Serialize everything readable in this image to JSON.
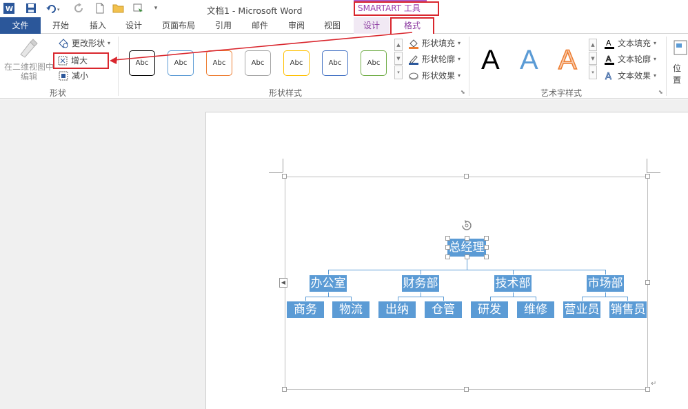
{
  "titlebar": {
    "doc_title": "文档1 - Microsoft Word",
    "tools_label": "SMARTART 工具"
  },
  "tabs": [
    "文件",
    "开始",
    "插入",
    "设计",
    "页面布局",
    "引用",
    "邮件",
    "审阅",
    "视图",
    "设计",
    "格式"
  ],
  "ribbon": {
    "shapes_group": {
      "edit_in_2d": "在二维视图中",
      "edit_in_2d_line2": "编辑",
      "change_shape": "更改形状",
      "enlarge": "增大",
      "shrink": "减小",
      "label": "形状"
    },
    "shape_styles": {
      "sample_text": "Abc",
      "styles": [
        {
          "border": "#000000"
        },
        {
          "border": "#5b9bd5"
        },
        {
          "border": "#ed7d31"
        },
        {
          "border": "#a5a5a5"
        },
        {
          "border": "#ffc000"
        },
        {
          "border": "#4472c4"
        },
        {
          "border": "#70ad47"
        }
      ],
      "fill": "形状填充",
      "outline": "形状轮廓",
      "effects": "形状效果",
      "label": "形状样式"
    },
    "wordart": {
      "letter": "A",
      "text_fill": "文本填充",
      "text_outline": "文本轮廓",
      "text_effects": "文本效果",
      "label": "艺术字样式"
    },
    "arrange": {
      "position": "位置"
    }
  },
  "org_chart": {
    "root": "总经理",
    "departments": [
      {
        "name": "办公室",
        "children": [
          "商务",
          "物流"
        ]
      },
      {
        "name": "财务部",
        "children": [
          "出纳",
          "仓管"
        ]
      },
      {
        "name": "技术部",
        "children": [
          "研发",
          "维修"
        ]
      },
      {
        "name": "市场部",
        "children": [
          "营业员",
          "销售员"
        ]
      }
    ]
  },
  "colors": {
    "file_tab": "#2b579a",
    "smartart_accent": "#9b3fae",
    "highlight_red": "#d9262d",
    "node_fill": "#5b9bd5"
  }
}
